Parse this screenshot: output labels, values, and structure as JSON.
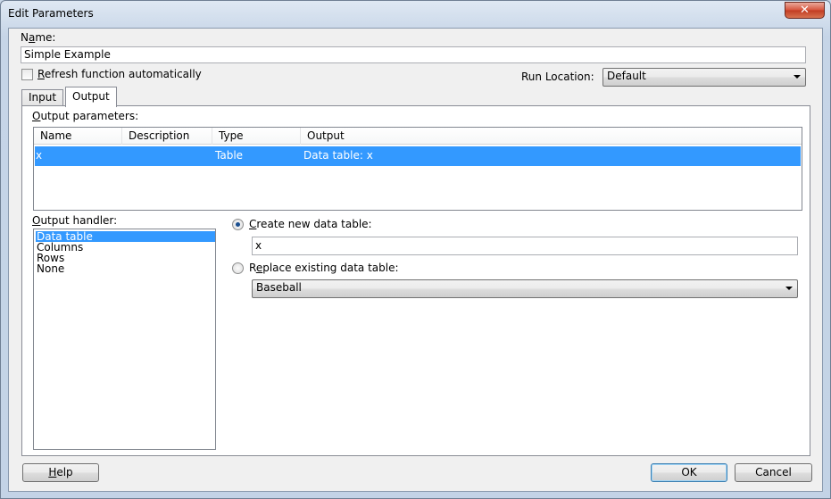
{
  "window": {
    "title": "Edit Parameters",
    "close_glyph": "✕"
  },
  "name_field": {
    "label_prefix": "N",
    "label_accel": "a",
    "label_rest": "me:",
    "value": "Simple Example"
  },
  "refresh_checkbox": {
    "label_accel": "R",
    "label_rest": "efresh function automatically",
    "checked": false
  },
  "run_location": {
    "label": "Run Location:",
    "value": "Default"
  },
  "tabs": [
    {
      "label": "Input",
      "active": false
    },
    {
      "label": "Output",
      "active": true
    }
  ],
  "output_parameters": {
    "label_accel": "O",
    "label_rest": "utput parameters:",
    "columns": [
      "Name",
      "Description",
      "Type",
      "Output"
    ],
    "rows": [
      {
        "name": "x",
        "description": "",
        "type": "Table",
        "output": "Data table: x",
        "selected": true
      }
    ]
  },
  "output_handler": {
    "label_accel": "O",
    "label_rest": "utput handler:",
    "items": [
      {
        "label": "Data table",
        "selected": true
      },
      {
        "label": "Columns",
        "selected": false
      },
      {
        "label": "Rows",
        "selected": false
      },
      {
        "label": "None",
        "selected": false
      }
    ]
  },
  "create_new": {
    "label_accel": "C",
    "label_rest": "reate new data table:",
    "selected": true,
    "value": "x"
  },
  "replace_existing": {
    "label_prefix": "R",
    "label_accel": "e",
    "label_rest": "place existing data table:",
    "selected": false,
    "value": "Baseball"
  },
  "buttons": {
    "help": {
      "accel": "H",
      "rest": "elp"
    },
    "ok": "OK",
    "cancel": "Cancel"
  },
  "colors": {
    "selection": "#3399ff",
    "client_bg": "#f0f0f0"
  }
}
